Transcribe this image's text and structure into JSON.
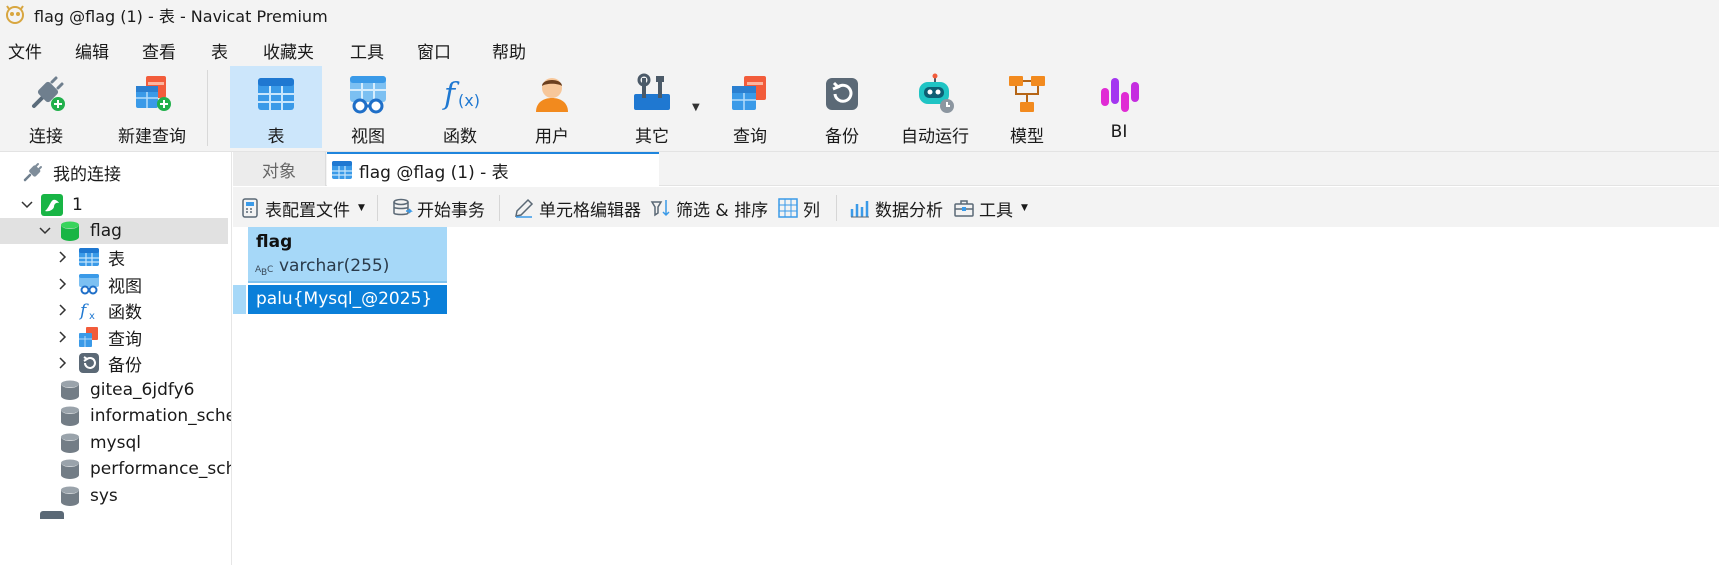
{
  "window": {
    "title": "flag @flag (1) - 表 - Navicat Premium",
    "app_icon": "navicat-logo-icon"
  },
  "menu": [
    "文件",
    "编辑",
    "查看",
    "表",
    "收藏夹",
    "工具",
    "窗口",
    "帮助"
  ],
  "toolbar": {
    "connect": "连接",
    "new_query": "新建查询",
    "table": "表",
    "view": "视图",
    "function": "函数",
    "user": "用户",
    "other": "其它",
    "query": "查询",
    "backup": "备份",
    "automation": "自动运行",
    "model": "模型",
    "bi": "BI"
  },
  "sidebar": {
    "root": "我的连接",
    "connection": "1",
    "database": "flag",
    "children": [
      "表",
      "视图",
      "函数",
      "查询",
      "备份"
    ],
    "databases": [
      "gitea_6jdfy6",
      "information_schema",
      "mysql",
      "performance_schema",
      "sys"
    ]
  },
  "tabs": {
    "objects": "对象",
    "active": "flag @flag (1) - 表"
  },
  "table_toolbar": {
    "profile": "表配置文件",
    "begin_transaction": "开始事务",
    "cell_editor": "单元格编辑器",
    "filter_sort": "筛选 & 排序",
    "columns": "列",
    "data_analysis": "数据分析",
    "tools": "工具"
  },
  "grid": {
    "columns": [
      {
        "name": "flag",
        "type": "varchar(255)"
      }
    ],
    "rows": [
      [
        "palu{Mysql_@2025}"
      ]
    ]
  },
  "colors": {
    "accent": "#0a7fd9",
    "header": "#a6d8f8",
    "toolbar_active": "#cce6fb"
  }
}
